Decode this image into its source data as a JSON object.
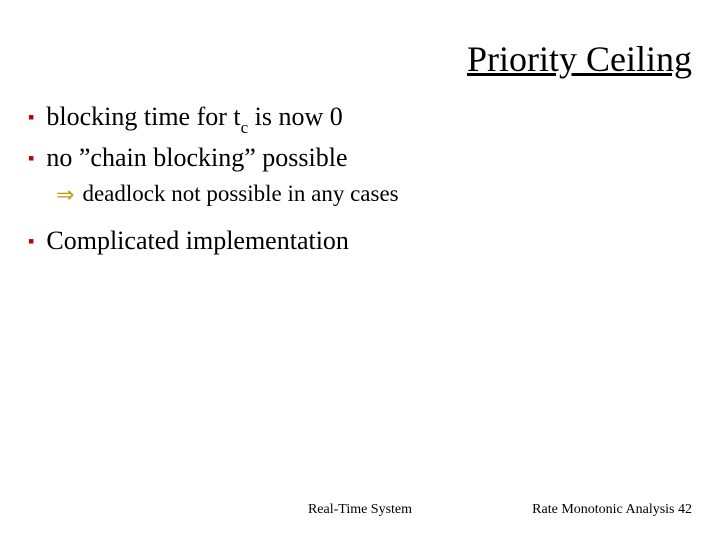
{
  "title": "Priority Ceiling",
  "bullets": {
    "b1_pre": "blocking time for ",
    "b1_tau": "t",
    "b1_sub": "c",
    "b1_post": " is now 0",
    "b2": "no ”chain blocking” possible",
    "sub1": "deadlock not possible in any cases",
    "b3": "Complicated implementation"
  },
  "markers": {
    "square": "▪",
    "arrow": "⇒"
  },
  "footer": {
    "center": "Real-Time System",
    "right_label": "Rate Monotonic Analysis ",
    "page": "42"
  }
}
